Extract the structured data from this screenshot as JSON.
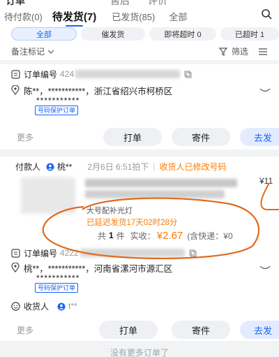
{
  "top_fragment": {
    "title": "订单",
    "mid1": "售后",
    "mid2": "评价"
  },
  "tabs": [
    {
      "label": "待付款(0)"
    },
    {
      "label": "待发货(7)"
    },
    {
      "label": "已发货(85)"
    },
    {
      "label": "全部"
    }
  ],
  "chips": [
    {
      "label": "全部"
    },
    {
      "label": "催发货"
    },
    {
      "label": "即将超时 0"
    },
    {
      "label": "已超时 1"
    }
  ],
  "remark": {
    "label": "备注标记",
    "filter_label": "筛选"
  },
  "order1": {
    "order_no_label": "订单编号",
    "order_no_visible": "424",
    "name": "陈**",
    "phone_mask": "，***********，",
    "address": "浙江省绍兴市柯桥区",
    "address2": "***********",
    "privacy_tag": "号码保护订单",
    "more": "更多",
    "print_label": "打单",
    "send_label": "寄件",
    "ship_label": "去发"
  },
  "order2": {
    "payer_label": "付款人",
    "payer_name": "桃**",
    "time": "2月6日 6:51拍下",
    "receiver_note": "收货人已修改号码",
    "price_frag": "¥11",
    "spec": "大号配补光灯",
    "delay": "已延迟发货17天02时28分",
    "qty_prefix": "共",
    "qty": "1",
    "qty_suffix": "件",
    "paid_label": "实收：",
    "paid_value": "¥2.67",
    "shipping_note": "(含快递：¥0",
    "order_no_label": "订单编号",
    "order_no_visible": "4222",
    "name": "桃**",
    "phone_mask": "，***********，",
    "address": "河南省漯河市源汇区",
    "address2": "***********",
    "privacy_tag": "号码保护订单",
    "receiver_label": "收货人",
    "receiver_name": "t**",
    "more": "更多",
    "print_label": "打单",
    "send_label": "寄件",
    "ship_label": "去发"
  },
  "footer": "没有更多订单了",
  "colors": {
    "accent": "#1c64f2",
    "warning": "#ff7a00",
    "scribble": "#e06a1c"
  }
}
